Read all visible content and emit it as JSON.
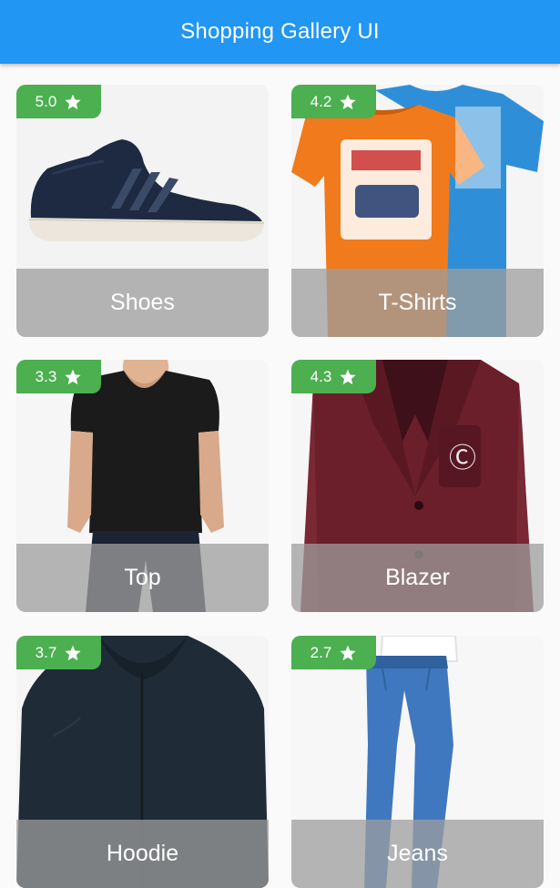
{
  "appbar": {
    "title": "Shopping Gallery UI",
    "color": "#2196f3"
  },
  "badge_color": "#4caf50",
  "products": [
    {
      "label": "Shoes",
      "rating": "5.0",
      "icon": "star-icon"
    },
    {
      "label": "T-Shirts",
      "rating": "4.2",
      "icon": "star-icon"
    },
    {
      "label": "Top",
      "rating": "3.3",
      "icon": "star-icon"
    },
    {
      "label": "Blazer",
      "rating": "4.3",
      "icon": "star-icon"
    },
    {
      "label": "Hoodie",
      "rating": "3.7",
      "icon": "star-icon"
    },
    {
      "label": "Jeans",
      "rating": "2.7",
      "icon": "star-icon"
    }
  ]
}
